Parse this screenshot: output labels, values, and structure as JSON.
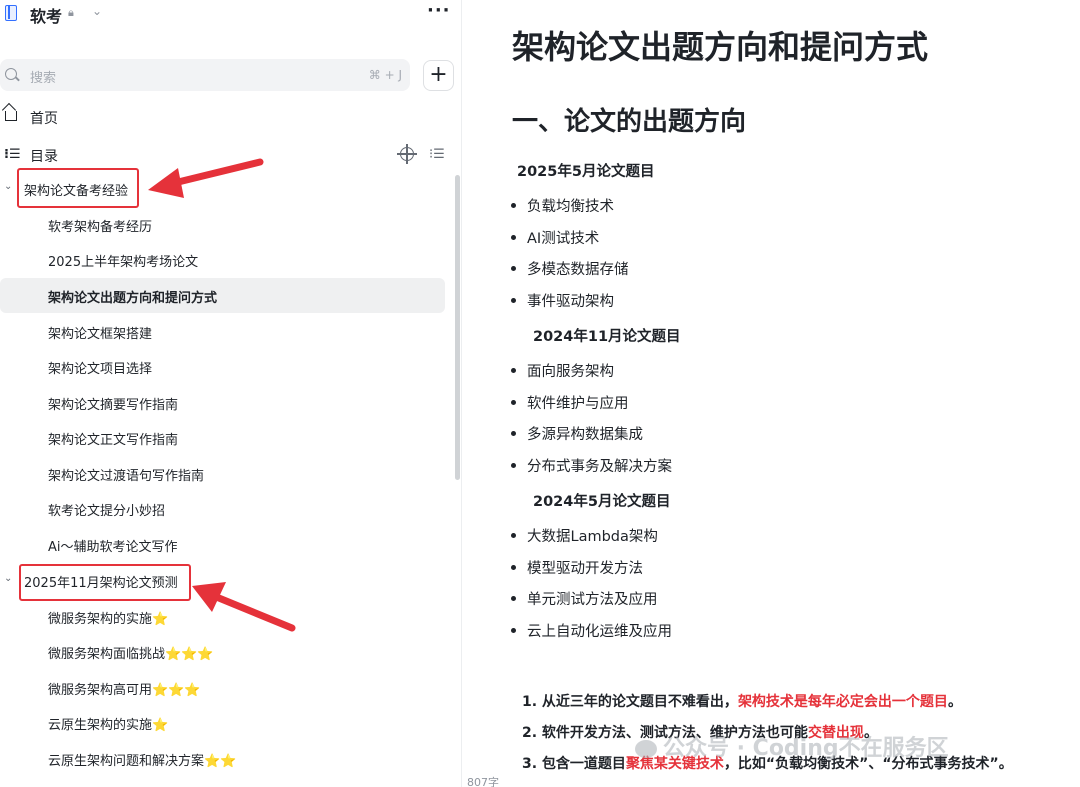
{
  "workspace": {
    "title": "软考"
  },
  "search": {
    "placeholder": "搜索",
    "shortcut": "⌘ + J"
  },
  "nav": {
    "home": "首页",
    "toc": "目录"
  },
  "tree": {
    "group1": "架构论文备考经验",
    "group1_items": [
      "软考架构备考经历",
      "2025上半年架构考场论文",
      "架构论文出题方向和提问方式",
      "架构论文框架搭建",
      "架构论文项目选择",
      "架构论文摘要写作指南",
      "架构论文正文写作指南",
      "架构论文过渡语句写作指南",
      "软考论文提分小妙招",
      "Ai～辅助软考论文写作"
    ],
    "group2": "2025年11月架构论文预测",
    "group2_items": [
      "微服务架构的实施⭐",
      "微服务架构面临挑战⭐⭐⭐",
      "微服务架构高可用⭐⭐⭐",
      "云原生架构的实施⭐",
      "云原生架构问题和解决方案⭐⭐"
    ]
  },
  "doc": {
    "title": "架构论文出题方向和提问方式",
    "h1": "一、论文的出题方向",
    "sections": [
      {
        "head": "2025年5月论文题目",
        "items": [
          "负载均衡技术",
          "AI测试技术",
          "多模态数据存储",
          "事件驱动架构"
        ]
      },
      {
        "head": "2024年11月论文题目",
        "items": [
          "面向服务架构",
          "软件维护与应用",
          "多源异构数据集成",
          "分布式事务及解决方案"
        ]
      },
      {
        "head": "2024年5月论文题目",
        "items": [
          "大数据Lambda架构",
          "模型驱动开发方法",
          "单元测试方法及应用",
          "云上自动化运维及应用"
        ]
      }
    ],
    "points": [
      {
        "pre": "1. 从近三年的论文题目不难看出，",
        "red": "架构技术是每年必定会出一个题目",
        "post": "。"
      },
      {
        "pre": "2. 软件开发方法、测试方法、维护方法也可能",
        "red": "交替出现",
        "post": "。"
      },
      {
        "pre": "3. 包含一道题目",
        "red": "聚焦某关键技术",
        "post": "，比如“负载均衡技术”、“分布式事务技术”。"
      }
    ],
    "wordcount": "807字"
  },
  "watermark": "公众号 · Coding不在服务区"
}
